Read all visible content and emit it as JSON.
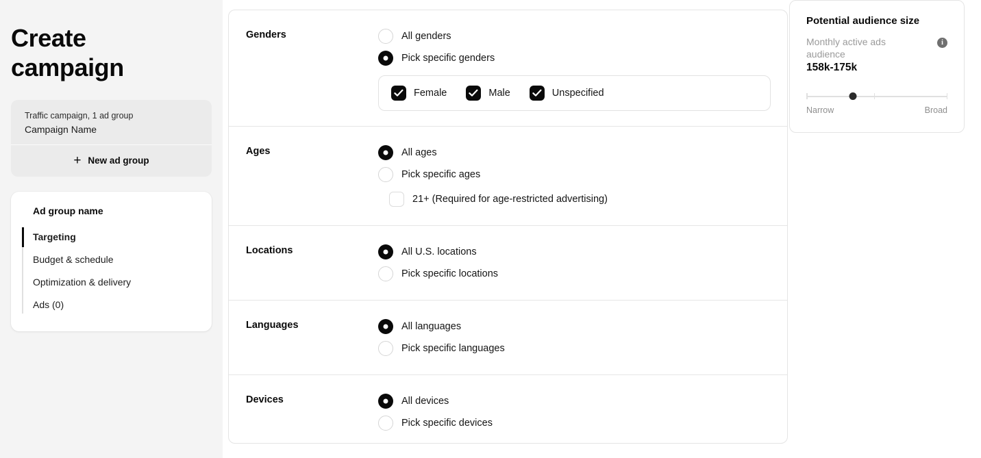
{
  "sidebar": {
    "title": "Create campaign",
    "campaign": {
      "summary": "Traffic campaign, 1 ad group",
      "name": "Campaign Name",
      "new_ad_group_label": "New ad group",
      "plus_icon": "plus-icon"
    },
    "ad_group": {
      "title": "Ad group name",
      "nav": [
        {
          "label": "Targeting",
          "active": true
        },
        {
          "label": "Budget & schedule",
          "active": false
        },
        {
          "label": "Optimization & delivery",
          "active": false
        },
        {
          "label": "Ads (0)",
          "active": false
        }
      ]
    }
  },
  "targeting": {
    "sections": [
      {
        "label": "Genders",
        "options": [
          {
            "label": "All genders",
            "selected": false
          },
          {
            "label": "Pick specific genders",
            "selected": true
          }
        ],
        "checkbox_group": [
          {
            "label": "Female",
            "checked": true
          },
          {
            "label": "Male",
            "checked": true
          },
          {
            "label": "Unspecified",
            "checked": true
          }
        ]
      },
      {
        "label": "Ages",
        "options": [
          {
            "label": "All ages",
            "selected": true
          },
          {
            "label": "Pick specific ages",
            "selected": false
          }
        ],
        "sub_checkbox": {
          "label": "21+ (Required for age-restricted advertising)",
          "checked": false
        }
      },
      {
        "label": "Locations",
        "options": [
          {
            "label": "All U.S. locations",
            "selected": true
          },
          {
            "label": "Pick specific locations",
            "selected": false
          }
        ]
      },
      {
        "label": "Languages",
        "options": [
          {
            "label": "All languages",
            "selected": true
          },
          {
            "label": "Pick specific languages",
            "selected": false
          }
        ]
      },
      {
        "label": "Devices",
        "options": [
          {
            "label": "All devices",
            "selected": true
          },
          {
            "label": "Pick specific devices",
            "selected": false
          }
        ]
      }
    ]
  },
  "audience": {
    "title": "Potential audience size",
    "subtitle": "Monthly active ads audience",
    "value": "158k-175k",
    "info_icon": "info-icon",
    "gauge": {
      "narrow_label": "Narrow",
      "broad_label": "Broad",
      "position_percent": 33
    }
  },
  "colors": {
    "accent": "#0a0a0a",
    "sidebar_bg": "#f4f4f4",
    "card_border": "#e4e4e4",
    "muted_text": "#9a9a9a"
  }
}
